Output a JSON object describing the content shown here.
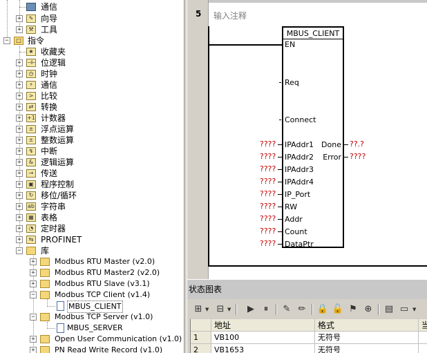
{
  "tree": {
    "items": [
      {
        "label": "通信",
        "icon": "monitor-icon"
      },
      {
        "label": "向导",
        "icon": "wizard-icon"
      },
      {
        "label": "工具",
        "icon": "tools-icon"
      },
      {
        "label": "指令",
        "icon": "instructions-folder-icon"
      },
      {
        "label": "收藏夹",
        "icon": "favorites-icon"
      },
      {
        "label": "位逻辑",
        "icon": "bit-logic-icon"
      },
      {
        "label": "时钟",
        "icon": "clock-icon"
      },
      {
        "label": "通信",
        "icon": "communication-icon"
      },
      {
        "label": "比较",
        "icon": "compare-icon"
      },
      {
        "label": "转换",
        "icon": "convert-icon"
      },
      {
        "label": "计数器",
        "icon": "counter-icon"
      },
      {
        "label": "浮点运算",
        "icon": "float-math-icon"
      },
      {
        "label": "整数运算",
        "icon": "integer-math-icon"
      },
      {
        "label": "中断",
        "icon": "interrupt-icon"
      },
      {
        "label": "逻辑运算",
        "icon": "logic-ops-icon"
      },
      {
        "label": "传送",
        "icon": "move-icon"
      },
      {
        "label": "程序控制",
        "icon": "program-control-icon"
      },
      {
        "label": "移位/循环",
        "icon": "shift-rotate-icon"
      },
      {
        "label": "字符串",
        "icon": "string-icon"
      },
      {
        "label": "表格",
        "icon": "table-icon"
      },
      {
        "label": "定时器",
        "icon": "timer-icon"
      },
      {
        "label": "PROFINET",
        "icon": "profinet-icon"
      },
      {
        "label": "库",
        "icon": "library-folder-icon"
      },
      {
        "label": "Modbus RTU Master (v2.0)",
        "icon": "folder-icon"
      },
      {
        "label": "Modbus RTU Master2 (v2.0)",
        "icon": "folder-icon"
      },
      {
        "label": "Modbus RTU Slave (v3.1)",
        "icon": "folder-icon"
      },
      {
        "label": "Modbus TCP Client (v1.4)",
        "icon": "folder-icon"
      },
      {
        "label": "MBUS_CLIENT",
        "icon": "page-icon"
      },
      {
        "label": "Modbus TCP Server (v1.0)",
        "icon": "folder-icon"
      },
      {
        "label": "MBUS_SERVER",
        "icon": "page-icon"
      },
      {
        "label": "Open User Communication (v1.0)",
        "icon": "folder-icon"
      },
      {
        "label": "PN Read Write Record (v1.0)",
        "icon": "folder-icon"
      }
    ]
  },
  "editor": {
    "network_number": "5",
    "comment_placeholder": "输入注释",
    "block": {
      "title": "MBUS_CLIENT",
      "en": "EN",
      "inputs": [
        "Req",
        "Connect",
        "IPAddr1",
        "IPAddr2",
        "IPAddr3",
        "IPAddr4",
        "IP_Port",
        "RW",
        "Addr",
        "Count",
        "DataPtr"
      ],
      "outputs": [
        "Done",
        "Error"
      ],
      "input_values": [
        "????",
        "????",
        "????",
        "????",
        "????",
        "????",
        "????",
        "????",
        "????"
      ],
      "output_values": [
        "??.?",
        "????"
      ]
    }
  },
  "status_chart": {
    "title": "状态图表",
    "columns": [
      "地址",
      "格式",
      "当"
    ],
    "rows": [
      {
        "num": "1",
        "address": "VB100",
        "format": "无符号"
      },
      {
        "num": "2",
        "address": "VB1653",
        "format": "无符号"
      }
    ]
  },
  "colors": {
    "undefined_operand": "#c00000",
    "chrome": "#d4d0c8"
  }
}
